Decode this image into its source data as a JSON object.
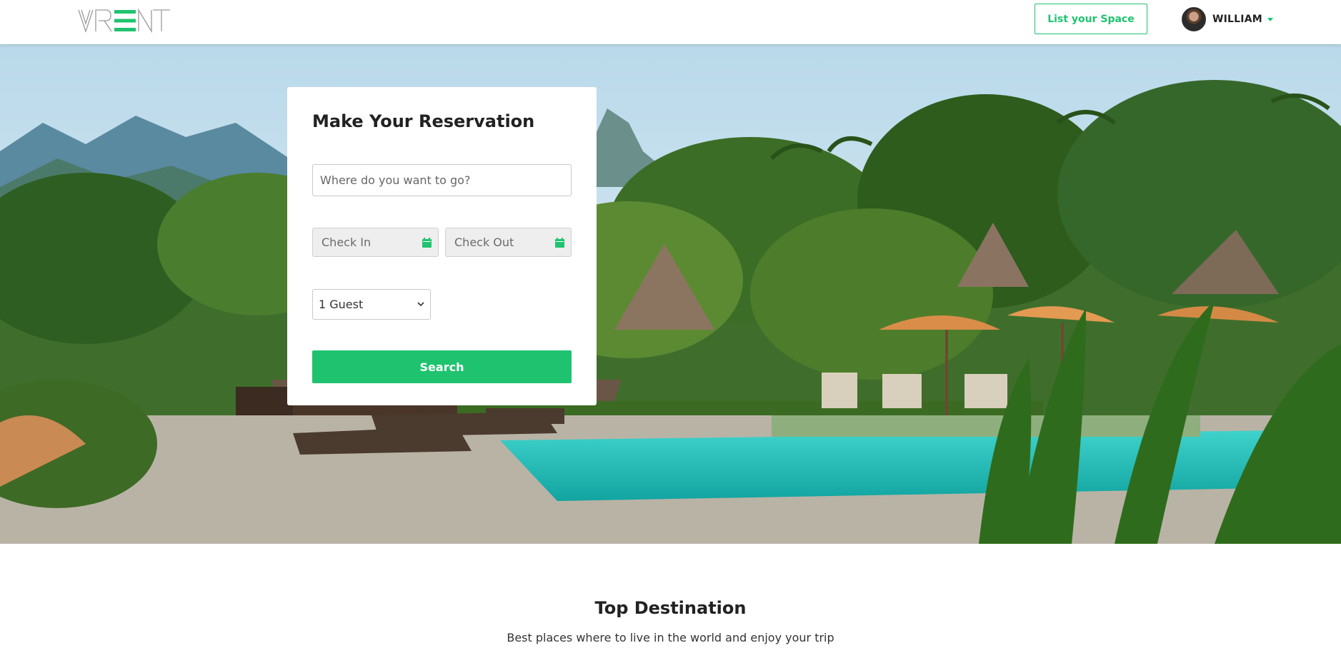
{
  "header": {
    "logo_text": "VRENT",
    "list_space_label": "List your Space",
    "user_name": "WILLIAM"
  },
  "reservation": {
    "title": "Make Your Reservation",
    "destination_placeholder": "Where do you want to go?",
    "destination_value": "",
    "check_in_label": "Check In",
    "check_out_label": "Check Out",
    "guest_selected": "1 Guest",
    "search_label": "Search"
  },
  "top_destination": {
    "title": "Top Destination",
    "subtitle": "Best places where to live in the world and enjoy your trip"
  },
  "icons": {
    "calendar": "calendar-icon",
    "caret": "caret-down-icon",
    "chevron": "chevron-down-icon",
    "avatar": "avatar"
  },
  "colors": {
    "accent": "#1fc36f",
    "text_dark": "#222222",
    "field_bg": "#eeeeee",
    "pool": "#1fb7b0"
  }
}
